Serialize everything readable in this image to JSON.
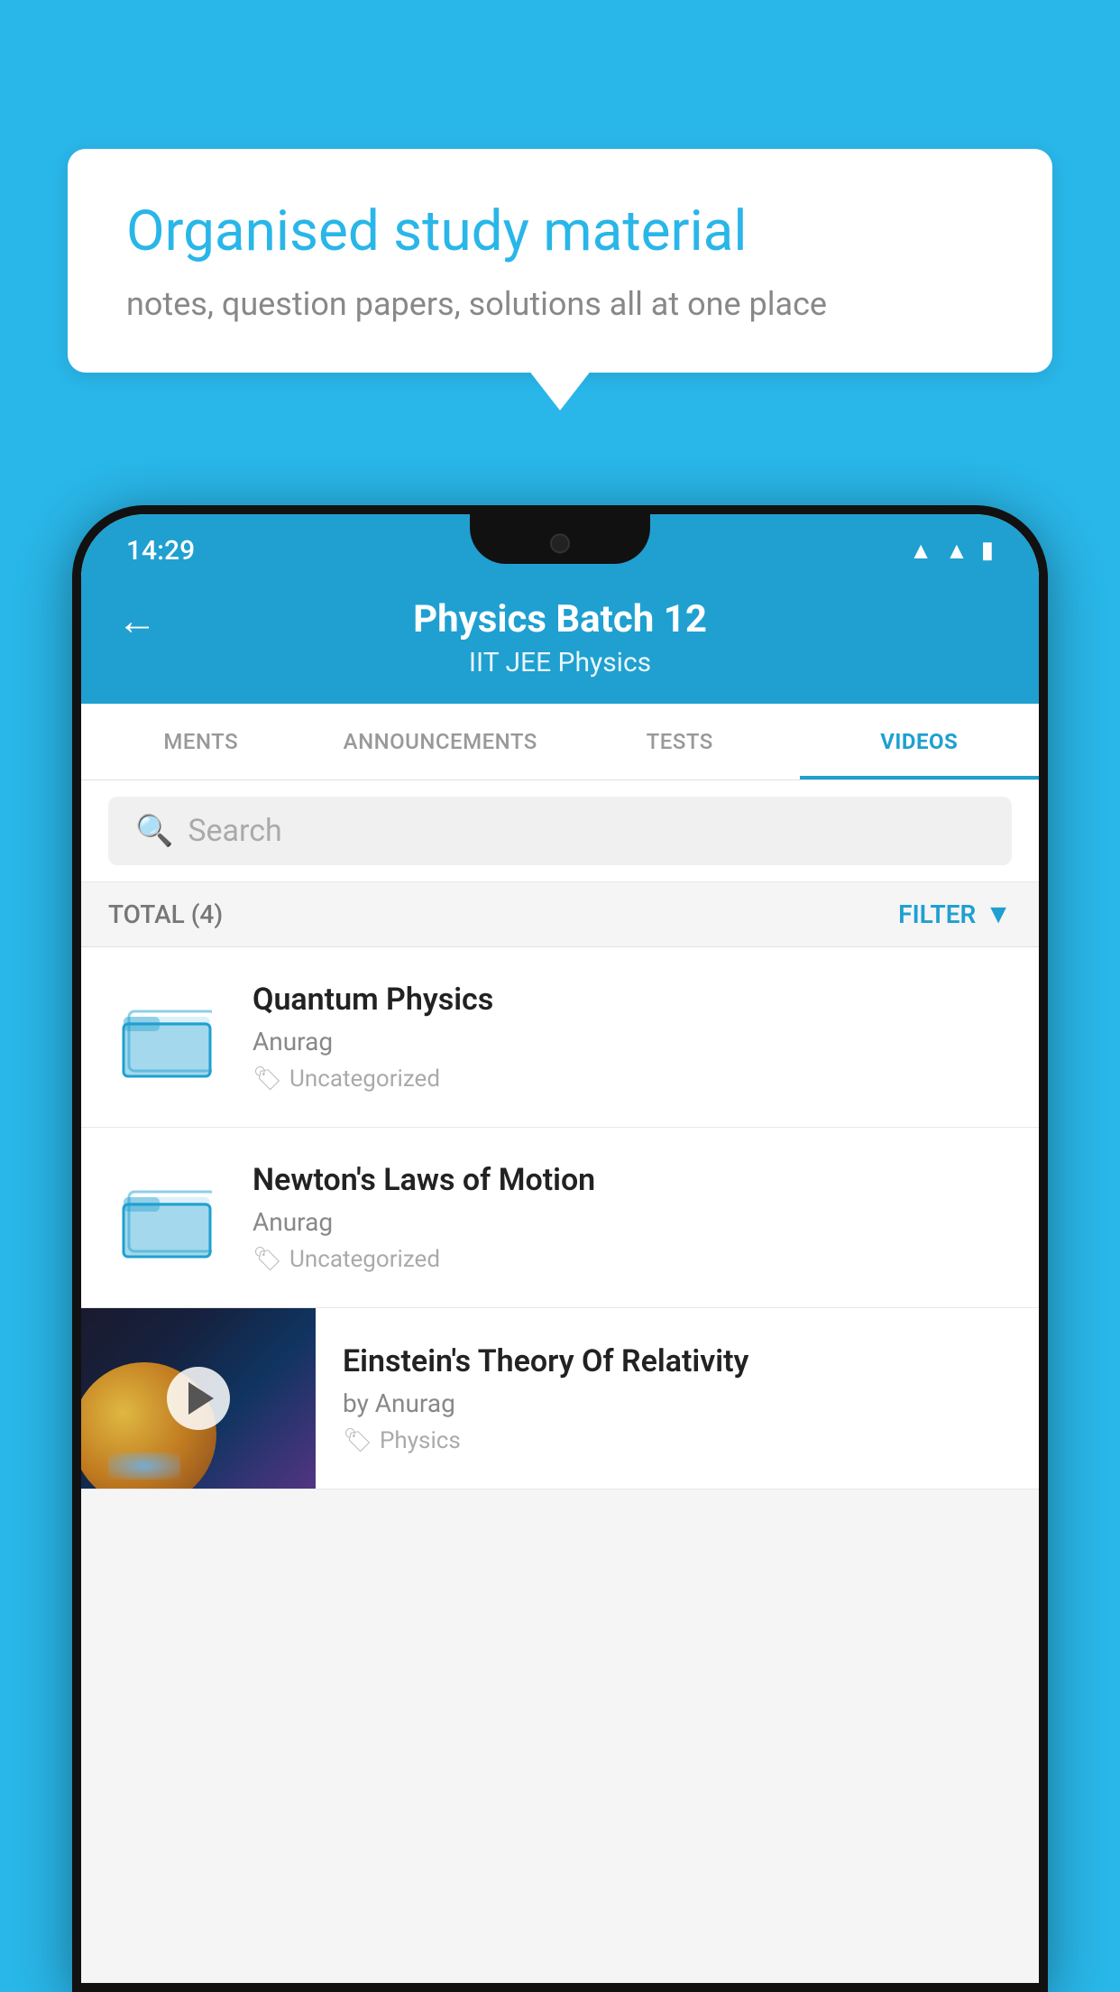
{
  "bubble": {
    "title": "Organised study material",
    "subtitle": "notes, question papers, solutions all at one place"
  },
  "status_bar": {
    "time": "14:29",
    "icons": [
      "wifi",
      "signal",
      "battery"
    ]
  },
  "header": {
    "back_label": "←",
    "title": "Physics Batch 12",
    "subtitle": "IIT JEE   Physics"
  },
  "tabs": [
    {
      "label": "MENTS",
      "active": false
    },
    {
      "label": "ANNOUNCEMENTS",
      "active": false
    },
    {
      "label": "TESTS",
      "active": false
    },
    {
      "label": "VIDEOS",
      "active": true
    }
  ],
  "search": {
    "placeholder": "Search"
  },
  "filter_bar": {
    "total_label": "TOTAL (4)",
    "filter_label": "FILTER"
  },
  "videos": [
    {
      "id": 1,
      "title": "Quantum Physics",
      "author": "Anurag",
      "tag": "Uncategorized",
      "has_thumbnail": false
    },
    {
      "id": 2,
      "title": "Newton's Laws of Motion",
      "author": "Anurag",
      "tag": "Uncategorized",
      "has_thumbnail": false
    },
    {
      "id": 3,
      "title": "Einstein's Theory Of Relativity",
      "author": "by Anurag",
      "tag": "Physics",
      "has_thumbnail": true
    }
  ]
}
